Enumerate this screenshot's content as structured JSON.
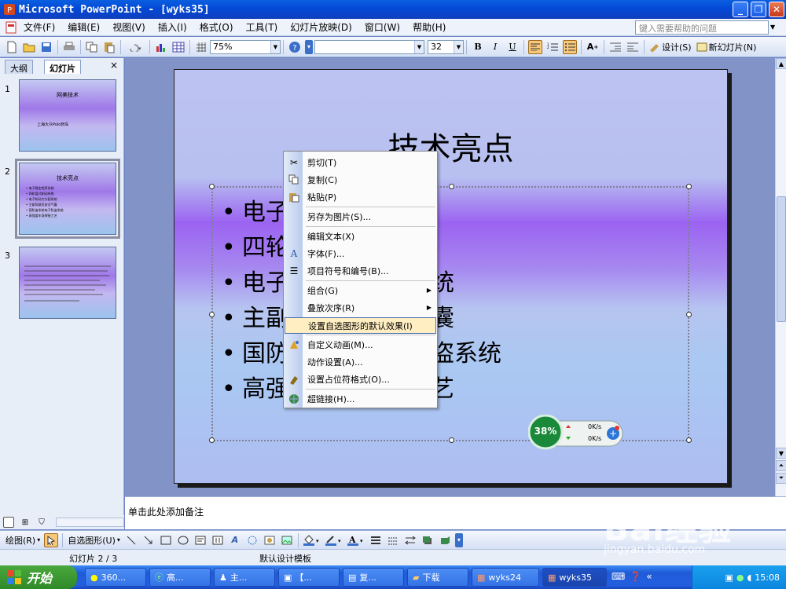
{
  "window": {
    "app_title": "Microsoft PowerPoint - [wyks35]"
  },
  "menubar": {
    "items": [
      "文件(F)",
      "编辑(E)",
      "视图(V)",
      "插入(I)",
      "格式(O)",
      "工具(T)",
      "幻灯片放映(D)",
      "窗口(W)",
      "帮助(H)"
    ],
    "help_placeholder": "键入需要帮助的问题"
  },
  "toolbar": {
    "zoom": "75%",
    "font_name": "",
    "font_size": "32",
    "design_label": "设计(S)",
    "new_slide_label": "新幻灯片(N)"
  },
  "leftpane": {
    "tabs": [
      "大纲",
      "幻灯片"
    ],
    "close": "×",
    "thumbnails": [
      {
        "num": "1",
        "title": "网美技术",
        "lines": [
          "上海大众Polo轿车"
        ]
      },
      {
        "num": "2",
        "title": "技术亮点",
        "lines": [
          "• 电子稳定程序系统",
          "• 四轮盘式制动系统",
          "• 电子制动力分配系统",
          "• 主副驾驶员安全气囊",
          "• 国防盗系统电子防盗系统",
          "• 高强度车身焊接工艺"
        ]
      },
      {
        "num": "3",
        "title": "",
        "lines": [
          "",
          "",
          "",
          "",
          "",
          "",
          "",
          ""
        ]
      }
    ]
  },
  "slide": {
    "title": "技术亮点",
    "bullets": [
      "电子稳定程序系统",
      "四轮盘式制动系统",
      "电子制动力分配系统",
      "主副驾驶员安全气囊",
      "国防盗系统电子防盗系统",
      "高强度车身焊接工艺"
    ]
  },
  "context_menu": {
    "items": [
      {
        "label": "剪切(T)",
        "icon": "scissors-icon"
      },
      {
        "label": "复制(C)",
        "icon": "copy-icon"
      },
      {
        "label": "粘贴(P)",
        "icon": "paste-icon"
      },
      {
        "label": "另存为图片(S)...",
        "icon": ""
      },
      {
        "label": "编辑文本(X)",
        "icon": ""
      },
      {
        "label": "字体(F)...",
        "icon": "font-icon"
      },
      {
        "label": "项目符号和编号(B)...",
        "icon": "bullets-icon"
      },
      {
        "label": "组合(G)",
        "icon": "",
        "submenu": true
      },
      {
        "label": "叠放次序(R)",
        "icon": "",
        "submenu": true
      },
      {
        "label": "设置自选图形的默认效果(I)",
        "icon": "",
        "highlighted": true
      },
      {
        "label": "自定义动画(M)...",
        "icon": "animation-icon"
      },
      {
        "label": "动作设置(A)...",
        "icon": ""
      },
      {
        "label": "设置占位符格式(O)...",
        "icon": "format-icon"
      },
      {
        "label": "超链接(H)...",
        "icon": "hyperlink-icon"
      }
    ]
  },
  "net_widget": {
    "percent": "38%",
    "up": "0K/s",
    "down": "0K/s"
  },
  "notes": {
    "placeholder": "单击此处添加备注"
  },
  "drawbar": {
    "draw_label": "绘图(R)",
    "autoshape_label": "自选图形(U)"
  },
  "status": {
    "slide_info": "幻灯片 2 / 3",
    "template": "默认设计模板"
  },
  "taskbar": {
    "start": "开始",
    "tasks": [
      "360...",
      "高...",
      "主...",
      "【...",
      "复...",
      "下载",
      "wyks24",
      "wyks35"
    ],
    "clock": "15:08"
  },
  "watermark": {
    "logo": "Bai经验",
    "url": "jingyan.baidu.com"
  },
  "colors": {
    "titlebar": "#0a5fe0",
    "slide_purple": "#9b63f1",
    "highlight": "#ffeec2"
  }
}
